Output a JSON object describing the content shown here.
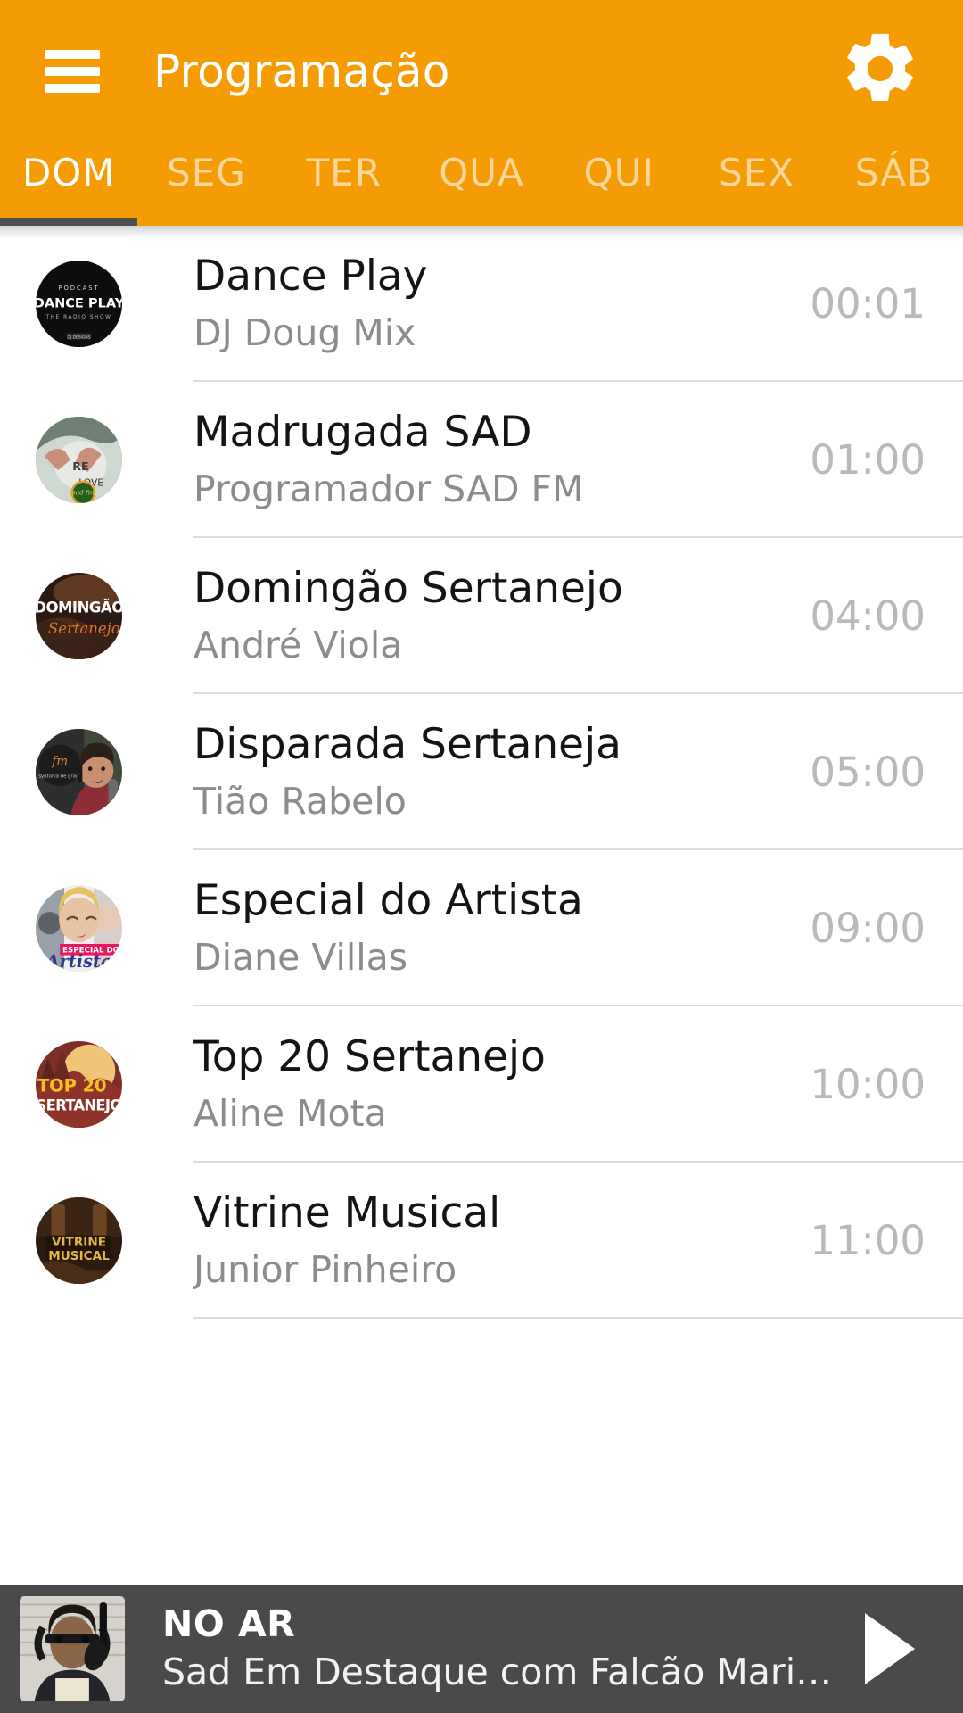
{
  "header": {
    "title": "Programação",
    "menu_icon": "hamburger-menu-icon",
    "settings_icon": "gear-icon"
  },
  "tabs": [
    {
      "label": "DOM",
      "active": true
    },
    {
      "label": "SEG",
      "active": false
    },
    {
      "label": "TER",
      "active": false
    },
    {
      "label": "QUA",
      "active": false
    },
    {
      "label": "QUI",
      "active": false
    },
    {
      "label": "SEX",
      "active": false
    },
    {
      "label": "SÁB",
      "active": false
    }
  ],
  "schedule": [
    {
      "title": "Dance Play",
      "host": "DJ Doug Mix",
      "time": "00:01",
      "art": "dance-play"
    },
    {
      "title": "Madrugada SAD",
      "host": "Programador SAD FM",
      "time": "01:00",
      "art": "madrugada"
    },
    {
      "title": "Domingão Sertanejo",
      "host": "André Viola",
      "time": "04:00",
      "art": "domingao"
    },
    {
      "title": "Disparada Sertaneja",
      "host": "Tião Rabelo",
      "time": "05:00",
      "art": "disparada"
    },
    {
      "title": "Especial do Artista",
      "host": "Diane Villas",
      "time": "09:00",
      "art": "especial"
    },
    {
      "title": "Top 20 Sertanejo",
      "host": "Aline Mota",
      "time": "10:00",
      "art": "top20"
    },
    {
      "title": "Vitrine Musical",
      "host": "Junior Pinheiro",
      "time": "11:00",
      "art": "vitrine"
    }
  ],
  "player": {
    "live_label": "NO AR",
    "now_playing": "Sad Em Destaque com Falcão Mari…",
    "play_icon": "play-icon",
    "art": "falcao"
  },
  "colors": {
    "brand_orange": "#f59c05",
    "tab_active_indicator": "#4f4f4f",
    "player_bar": "#4a4a4a",
    "title_text": "#141414",
    "sub_text": "#8c8c8c",
    "time_text": "#b9b9b9",
    "divider": "#dcdcdc"
  }
}
